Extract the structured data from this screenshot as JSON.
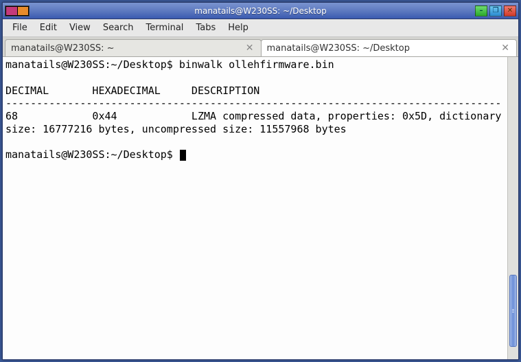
{
  "window": {
    "title": "manatails@W230SS: ~/Desktop"
  },
  "menus": {
    "file": "File",
    "edit": "Edit",
    "view": "View",
    "search": "Search",
    "terminal": "Terminal",
    "tabs": "Tabs",
    "help": "Help"
  },
  "tabs": [
    {
      "label": "manatails@W230SS: ~",
      "active": false
    },
    {
      "label": "manatails@W230SS: ~/Desktop",
      "active": true
    }
  ],
  "terminal": {
    "prompt1": "manatails@W230SS:~/Desktop$ ",
    "command": "binwalk ollehfirmware.bin",
    "header": "DECIMAL       HEXADECIMAL     DESCRIPTION",
    "sep": "--------------------------------------------------------------------------------",
    "row": "68            0x44            LZMA compressed data, properties: 0x5D, dictionary size: 16777216 bytes, uncompressed size: 11557968 bytes",
    "prompt2": "manatails@W230SS:~/Desktop$ "
  }
}
